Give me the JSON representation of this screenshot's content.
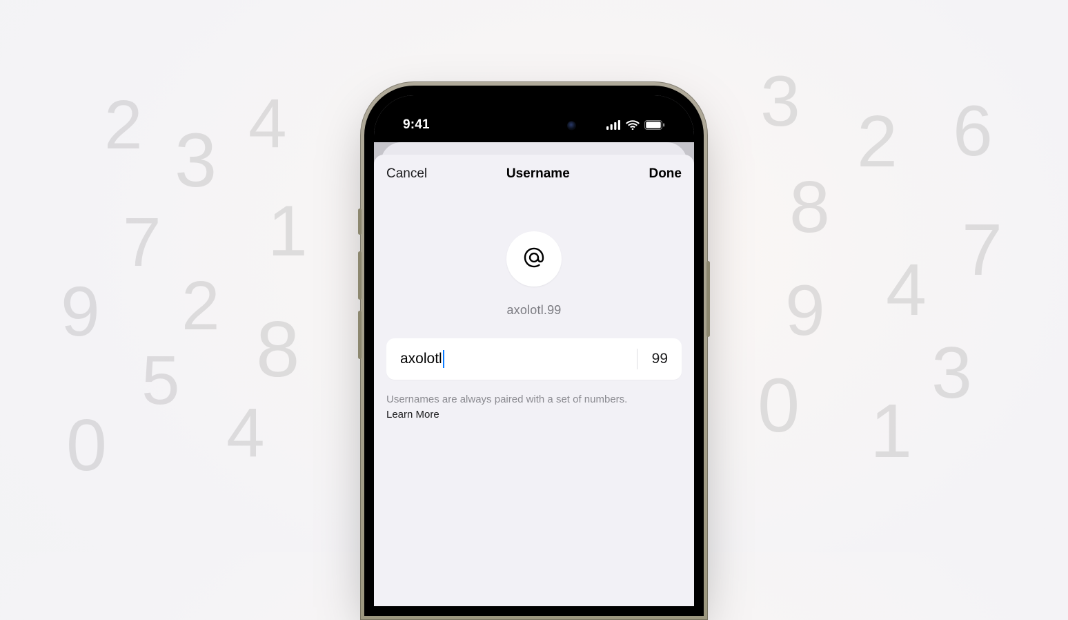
{
  "status": {
    "time": "9:41"
  },
  "nav": {
    "cancel": "Cancel",
    "title": "Username",
    "done": "Done"
  },
  "preview": "axolotl.99",
  "input": {
    "value": "axolotl",
    "suffix": "99"
  },
  "helper": {
    "text": "Usernames are always paired with a set of numbers.",
    "link": "Learn More"
  },
  "bg_numbers": {
    "left": [
      "2",
      "4",
      "3",
      "7",
      "1",
      "9",
      "2",
      "5",
      "8",
      "4",
      "0"
    ],
    "right": [
      "3",
      "2",
      "6",
      "8",
      "7",
      "9",
      "4",
      "3",
      "0",
      "1"
    ]
  }
}
